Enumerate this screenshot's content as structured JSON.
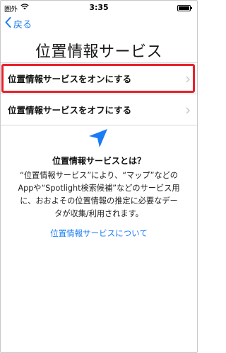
{
  "status_bar": {
    "carrier": "圏外",
    "time": "3:35"
  },
  "nav": {
    "back_label": "戻る"
  },
  "page": {
    "title": "位置情報サービス"
  },
  "options": [
    {
      "label": "位置情報サービスをオンにする",
      "highlighted": true
    },
    {
      "label": "位置情報サービスをオフにする",
      "highlighted": false
    }
  ],
  "info": {
    "heading": "位置情報サービスとは？",
    "lines": [
      "“位置情報サービス”により、“マップ”などの",
      "Appや“Spotlight検索候補”などのサービス用",
      "に、おおよその位置情報の推定に必要なデー",
      "タが収集/利用されます。"
    ],
    "link": "位置情報サービスについて"
  },
  "colors": {
    "accent": "#1a7cf5",
    "highlight_border": "#e8202a"
  },
  "icons": [
    "wifi-icon",
    "battery-icon",
    "back-chevron-icon",
    "chevron-right-icon",
    "location-arrow-icon"
  ]
}
